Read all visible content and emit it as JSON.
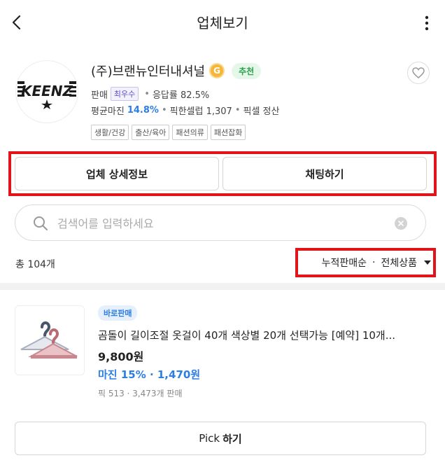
{
  "header": {
    "title": "업체보기",
    "back_icon": "chevron-left-icon",
    "more_icon": "more-vertical-icon"
  },
  "vendor": {
    "logo_text": "KEENZ",
    "name": "(주)브랜뉴인터내셔널",
    "grade_icon_letter": "G",
    "recommend_badge": "추천",
    "sales_label": "판매",
    "sales_grade": "최우수",
    "response_rate": "응답률 82.5%",
    "avg_margin_label": "평균마진",
    "avg_margin_value": "14.8%",
    "pick_sellers": "픽한셀럽 1,307",
    "settlement": "픽셀 정산",
    "tags": [
      "생활/건강",
      "출산/육아",
      "패션의류",
      "패션잡화"
    ],
    "colors": {
      "accent_blue": "#2b7ee4",
      "recommend_green": "#2e9e4f",
      "highlight_red": "#e0141b"
    }
  },
  "actions": {
    "detail_label": "업체 상세정보",
    "chat_label": "채팅하기"
  },
  "search": {
    "placeholder": "검색어를 입력하세요",
    "value": ""
  },
  "list_header": {
    "total": "총 104개",
    "sort_label": "누적판매순",
    "filter_label": "전체상품"
  },
  "products": [
    {
      "badge": "바로판매",
      "title": "곰돌이 길이조절 옷걸이 40개 색상별 20개 선택가능 [예약] 10개...",
      "price": "9,800원",
      "margin": "마진 15% · 1,470원",
      "stats": "픽 513 · 3,473개 판매",
      "pick_prefix": "Pick",
      "pick_suffix": "하기"
    }
  ]
}
